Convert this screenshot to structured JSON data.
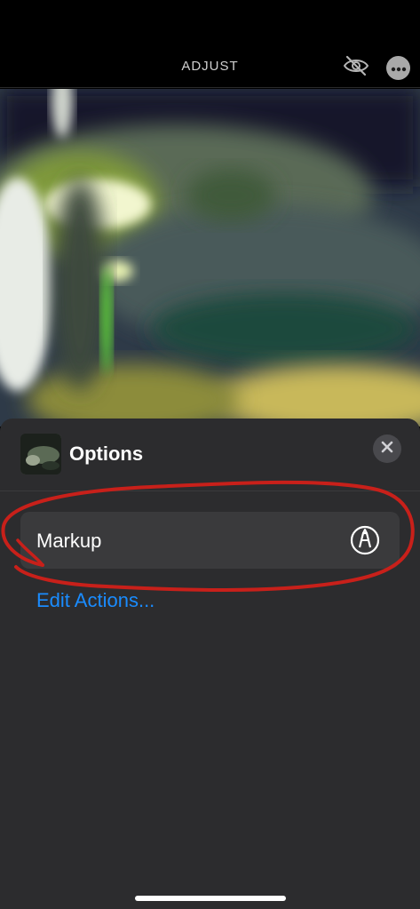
{
  "topbar": {
    "title": "ADJUST",
    "hide_icon": "eye-slash-icon",
    "more_icon": "ellipsis-circle-icon"
  },
  "photo": {
    "alt_icon": "photo-image"
  },
  "sheet": {
    "title": "Options",
    "close_icon": "xmark-icon",
    "actions": [
      {
        "label": "Markup",
        "icon": "markup-pen-icon"
      }
    ],
    "edit_actions_label": "Edit Actions..."
  },
  "colors": {
    "accent": "#1a8cff",
    "sheet_bg": "#2c2c2e",
    "row_bg": "#3a3a3c",
    "annotation": "#c8201a"
  }
}
